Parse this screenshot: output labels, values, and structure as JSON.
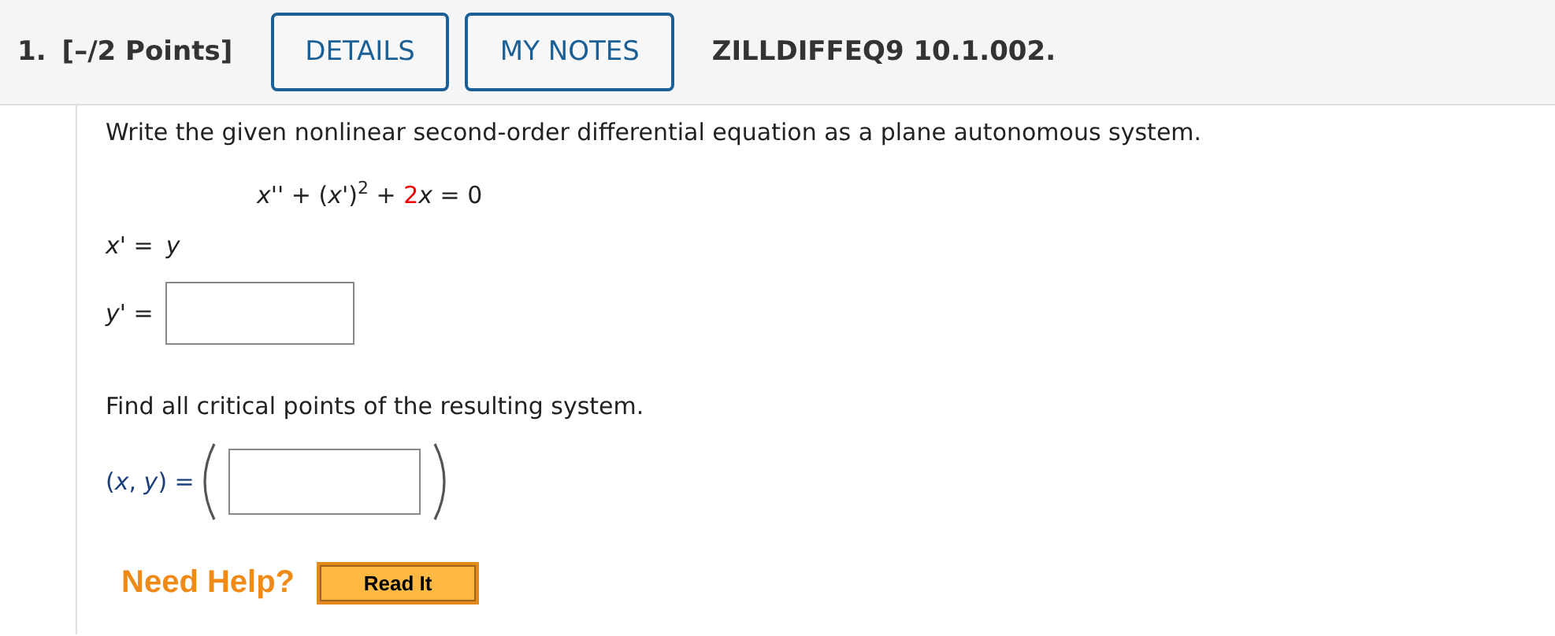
{
  "header": {
    "number": "1.",
    "points": "[–/2 Points]",
    "buttons": [
      "DETAILS",
      "MY NOTES"
    ],
    "question_id": "ZILLDIFFEQ9 10.1.002."
  },
  "prompt": "Write the given nonlinear second-order differential equation as a plane autonomous system.",
  "equation": [
    {
      "kind": "plain",
      "text": "*x*'' + (*x*')$^{2}$ + "
    },
    {
      "kind": "coefficient",
      "text": "2"
    },
    {
      "kind": "plain",
      "text": "*x* = 0"
    }
  ],
  "system": [
    {
      "label": "*x*' = ",
      "kind": "text",
      "value": "*y*"
    },
    {
      "label": "*y*' = ",
      "kind": "field"
    }
  ],
  "critical_prompt": "Find all critical points of the resulting system.",
  "critical_label": "(*x*, *y*) = ",
  "help": {
    "label": "Need Help?",
    "buttons": [
      "Read It"
    ]
  }
}
